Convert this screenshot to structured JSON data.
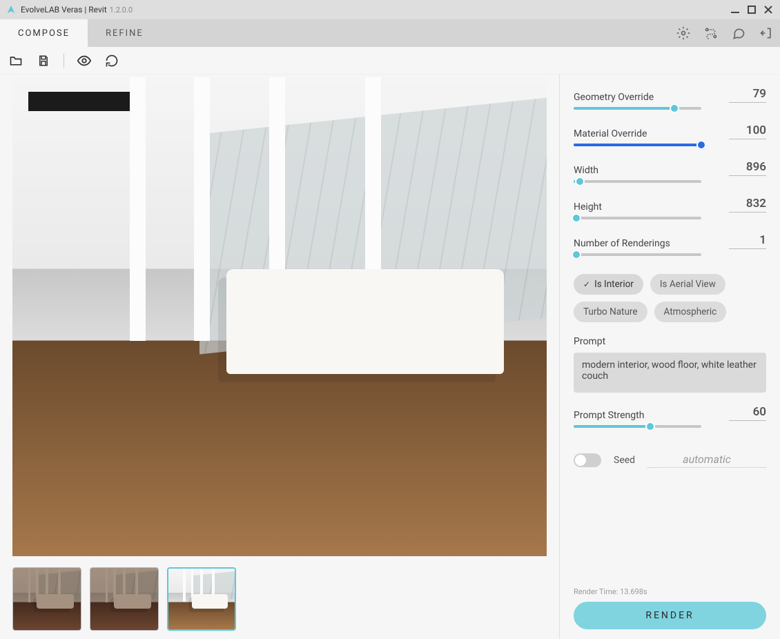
{
  "titlebar": {
    "app": "EvolveLAB Veras | Revit",
    "version": "1.2.0.0"
  },
  "tabs": {
    "compose": "COMPOSE",
    "refine": "REFINE"
  },
  "sliders": {
    "geometry": {
      "label": "Geometry Override",
      "value": "79",
      "pct": 79,
      "style": "teal"
    },
    "material": {
      "label": "Material Override",
      "value": "100",
      "pct": 100,
      "style": "blue"
    },
    "width": {
      "label": "Width",
      "value": "896",
      "pct": 5,
      "style": "teal"
    },
    "height": {
      "label": "Height",
      "value": "832",
      "pct": 2,
      "style": "teal"
    },
    "count": {
      "label": "Number of Renderings",
      "value": "1",
      "pct": 2,
      "style": "teal"
    },
    "promptStrength": {
      "label": "Prompt Strength",
      "value": "60",
      "pct": 60,
      "style": "teal"
    }
  },
  "chips": {
    "interior": {
      "label": "Is Interior",
      "active": true
    },
    "aerial": {
      "label": "Is Aerial View",
      "active": false
    },
    "turbo": {
      "label": "Turbo Nature",
      "active": false
    },
    "atmos": {
      "label": "Atmospheric",
      "active": false
    }
  },
  "prompt": {
    "label": "Prompt",
    "text": "modern interior, wood floor, white leather couch"
  },
  "seed": {
    "label": "Seed",
    "value": "automatic"
  },
  "renderTime": "Render Time: 13.698s",
  "renderBtn": "RENDER"
}
